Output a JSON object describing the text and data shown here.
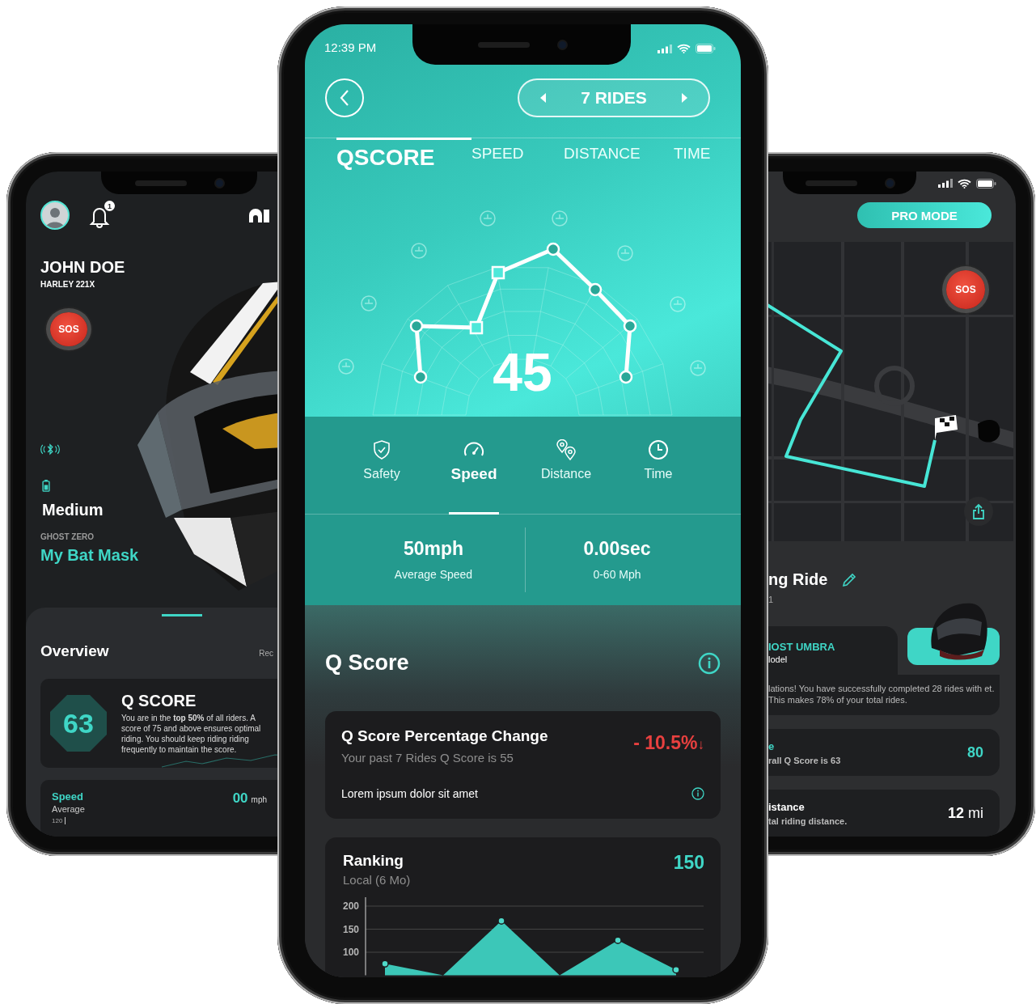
{
  "left_phone": {
    "notification_count": "1",
    "profile": {
      "name": "JOHN DOE",
      "bike": "HARLEY 221X"
    },
    "sos_button": "SOS",
    "battery": {
      "label": "Medium"
    },
    "helmet": {
      "model": "GHOST ZERO",
      "name": "My Bat Mask"
    },
    "overview": {
      "title": "Overview",
      "link": "Rec",
      "qscore": {
        "value": "63",
        "title": "Q SCORE",
        "text": "You are in the **top 50%** of all riders. A score of 75 and above ensures optimal riding. You should keep riding riding frequently to maintain the score."
      },
      "speed": {
        "title": "Speed",
        "subtitle": "Average",
        "value": "00",
        "unit": "mph",
        "axis_label": "120"
      }
    }
  },
  "center_phone": {
    "status_bar": {
      "time": "12:39 PM"
    },
    "ride_selector": {
      "label": "7 RIDES"
    },
    "tabs": [
      {
        "label": "QSCORE",
        "selected": true
      },
      {
        "label": "SPEED",
        "selected": false
      },
      {
        "label": "DISTANCE",
        "selected": false
      },
      {
        "label": "TIME",
        "selected": false
      }
    ],
    "score": "45",
    "metric_tabs": [
      {
        "label": "Safety",
        "selected": false
      },
      {
        "label": "Speed",
        "selected": true
      },
      {
        "label": "Distance",
        "selected": false
      },
      {
        "label": "Time",
        "selected": false
      }
    ],
    "stats": [
      {
        "value": "50mph",
        "label": "Average Speed"
      },
      {
        "value": "0.00sec",
        "label": "0-60 Mph"
      }
    ],
    "section_title": "Q Score",
    "change_card": {
      "title": "Q Score Percentage Change",
      "subtitle": "Your past 7 Rides Q Score is 55",
      "change": "- 10.5%",
      "arrow": "↓",
      "note": "Lorem ipsum dolor sit amet"
    },
    "ranking_card": {
      "title": "Ranking",
      "subtitle": "Local (6 Mo)",
      "value": "150",
      "chart_data": {
        "type": "area",
        "values": [
          75,
          null,
          168,
          null,
          126,
          62
        ],
        "ylim": [
          50,
          200
        ],
        "yticks": [
          100,
          150,
          200
        ]
      }
    }
  },
  "right_phone": {
    "mode_button": "PRO MODE",
    "sos_button": "SOS",
    "ride": {
      "title": "ng Ride",
      "subtitle": "1"
    },
    "helmet_card": {
      "name": "IOST UMBRA",
      "label": "lodel"
    },
    "message": "lations! You have successfully completed 28 rides with et. This makes 78% of your total rides.",
    "stats": [
      {
        "kind": "accent",
        "title": "e",
        "subtitle": "rall Q Score is 63",
        "value": "80"
      },
      {
        "kind": "plain",
        "title": "istance",
        "subtitle": "tal riding distance.",
        "value": "12",
        "unit": "mi"
      }
    ]
  }
}
